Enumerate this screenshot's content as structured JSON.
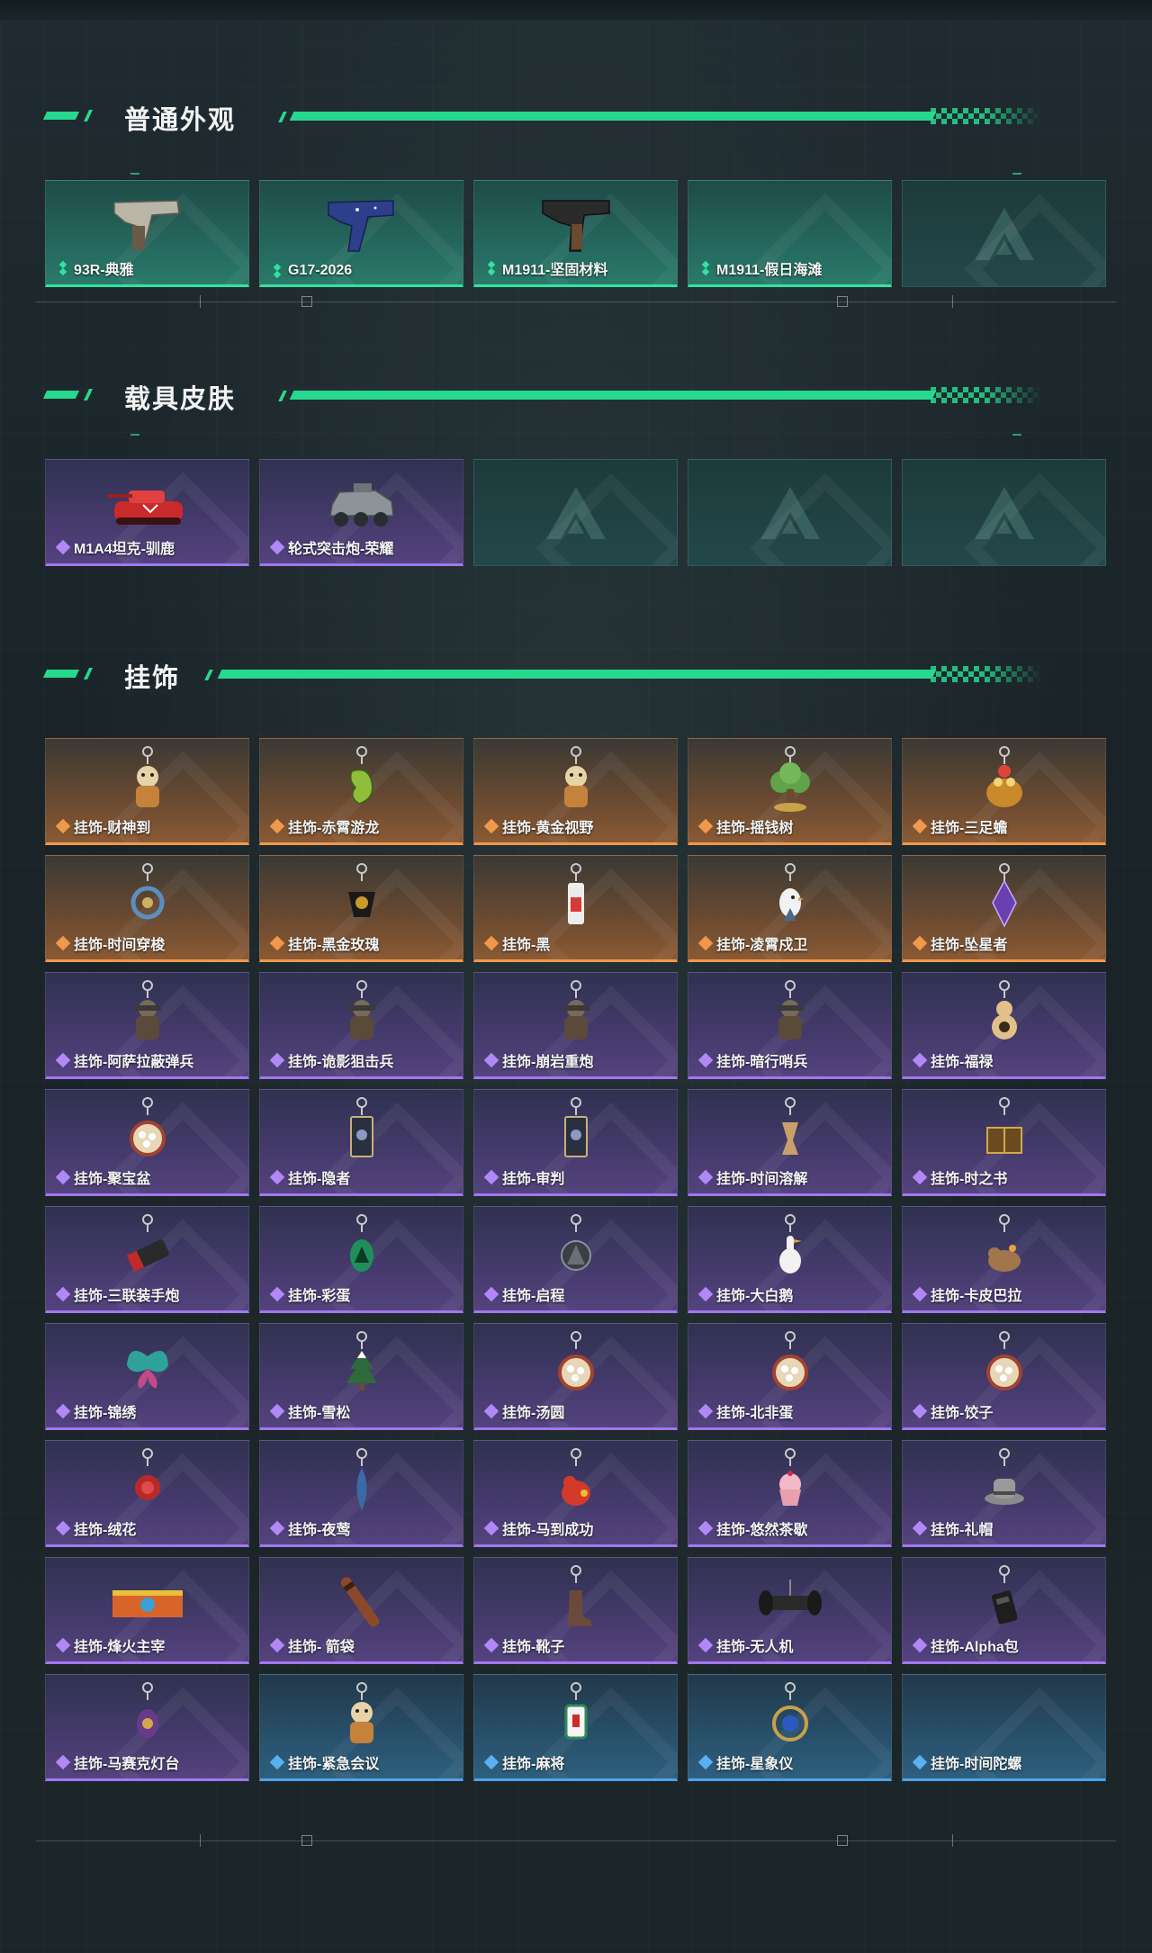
{
  "colors": {
    "accent": "#27d88f",
    "green": "#2fe3a2",
    "orange": "#f0984c",
    "purple": "#a276f0",
    "blue": "#4fa3e8"
  },
  "sections": [
    {
      "title": "普通外观",
      "items": [
        {
          "label": "93R-典雅",
          "rarity": "green",
          "icon": "pistol-silver-icon"
        },
        {
          "label": "G17-2026",
          "rarity": "green",
          "icon": "pistol-blue-icon"
        },
        {
          "label": "M1911-坚固材料",
          "rarity": "green",
          "icon": "pistol-black-icon"
        },
        {
          "label": "M1911-假日海滩",
          "rarity": "green",
          "icon": "pistol-empty-icon"
        },
        {
          "label": "",
          "rarity": "empty",
          "icon": "placeholder-logo-icon"
        }
      ]
    },
    {
      "title": "载具皮肤",
      "items": [
        {
          "label": "M1A4坦克-驯鹿",
          "rarity": "purple",
          "icon": "tank-icon"
        },
        {
          "label": "轮式突击炮-荣耀",
          "rarity": "purple",
          "icon": "armored-vehicle-icon"
        },
        {
          "label": "",
          "rarity": "empty",
          "icon": "placeholder-logo-icon"
        },
        {
          "label": "",
          "rarity": "empty",
          "icon": "placeholder-logo-icon"
        },
        {
          "label": "",
          "rarity": "empty",
          "icon": "placeholder-logo-icon"
        }
      ]
    },
    {
      "title": "挂饰",
      "items": [
        {
          "label": "挂饰-财神到",
          "rarity": "orange",
          "icon": "charm-figure-icon"
        },
        {
          "label": "挂饰-赤霄游龙",
          "rarity": "orange",
          "icon": "charm-dragon-icon"
        },
        {
          "label": "挂饰-黄金视野",
          "rarity": "orange",
          "icon": "charm-figure-icon"
        },
        {
          "label": "挂饰-摇钱树",
          "rarity": "orange",
          "icon": "charm-tree-icon"
        },
        {
          "label": "挂饰-三足蟾",
          "rarity": "orange",
          "icon": "charm-toad-icon"
        },
        {
          "label": "挂饰-时间穿梭",
          "rarity": "orange",
          "icon": "charm-ring-icon"
        },
        {
          "label": "挂饰-黑金玫瑰",
          "rarity": "orange",
          "icon": "charm-rose-icon"
        },
        {
          "label": "挂饰-黑",
          "rarity": "orange",
          "icon": "charm-tag-icon"
        },
        {
          "label": "挂饰-凌霄戍卫",
          "rarity": "orange",
          "icon": "charm-bird-icon"
        },
        {
          "label": "挂饰-坠星者",
          "rarity": "orange",
          "icon": "charm-crystal-icon"
        },
        {
          "label": "挂饰-阿萨拉蔽弹兵",
          "rarity": "purple",
          "icon": "charm-soldier-icon"
        },
        {
          "label": "挂饰-诡影狙击兵",
          "rarity": "purple",
          "icon": "charm-soldier-icon"
        },
        {
          "label": "挂饰-崩岩重炮",
          "rarity": "purple",
          "icon": "charm-soldier-icon"
        },
        {
          "label": "挂饰-暗行哨兵",
          "rarity": "purple",
          "icon": "charm-soldier-icon"
        },
        {
          "label": "挂饰-福禄",
          "rarity": "purple",
          "icon": "charm-gourd-icon"
        },
        {
          "label": "挂饰-聚宝盆",
          "rarity": "purple",
          "icon": "charm-bowl-icon"
        },
        {
          "label": "挂饰-隐者",
          "rarity": "purple",
          "icon": "charm-card-icon"
        },
        {
          "label": "挂饰-审判",
          "rarity": "purple",
          "icon": "charm-card-icon"
        },
        {
          "label": "挂饰-时间溶解",
          "rarity": "purple",
          "icon": "charm-clock-icon"
        },
        {
          "label": "挂饰-时之书",
          "rarity": "purple",
          "icon": "charm-book-icon"
        },
        {
          "label": "挂饰-三联装手炮",
          "rarity": "purple",
          "icon": "charm-launcher-icon"
        },
        {
          "label": "挂饰-彩蛋",
          "rarity": "purple",
          "icon": "charm-egg-icon"
        },
        {
          "label": "挂饰-启程",
          "rarity": "purple",
          "icon": "charm-emblem-icon"
        },
        {
          "label": "挂饰-大白鹅",
          "rarity": "purple",
          "icon": "charm-goose-icon"
        },
        {
          "label": "挂饰-卡皮巴拉",
          "rarity": "purple",
          "icon": "charm-capybara-icon"
        },
        {
          "label": "挂饰-锦绣",
          "rarity": "purple",
          "icon": "charm-butterfly-icon"
        },
        {
          "label": "挂饰-雪松",
          "rarity": "purple",
          "icon": "charm-pine-icon"
        },
        {
          "label": "挂饰-汤圆",
          "rarity": "purple",
          "icon": "charm-bowl-icon"
        },
        {
          "label": "挂饰-北非蛋",
          "rarity": "purple",
          "icon": "charm-bowl-icon"
        },
        {
          "label": "挂饰-饺子",
          "rarity": "purple",
          "icon": "charm-bowl-icon"
        },
        {
          "label": "挂饰-绒花",
          "rarity": "purple",
          "icon": "charm-flower-icon"
        },
        {
          "label": "挂饰-夜莺",
          "rarity": "purple",
          "icon": "charm-feather-icon"
        },
        {
          "label": "挂饰-马到成功",
          "rarity": "purple",
          "icon": "charm-horse-icon"
        },
        {
          "label": "挂饰-悠然茶歇",
          "rarity": "purple",
          "icon": "charm-cupcake-icon"
        },
        {
          "label": "挂饰-礼帽",
          "rarity": "purple",
          "icon": "charm-hat-icon"
        },
        {
          "label": "挂饰-烽火主宰",
          "rarity": "purple",
          "icon": "charm-banner-icon"
        },
        {
          "label": "挂饰- 箭袋",
          "rarity": "purple",
          "icon": "charm-quiver-icon"
        },
        {
          "label": "挂饰-靴子",
          "rarity": "purple",
          "icon": "charm-boot-icon"
        },
        {
          "label": "挂饰-无人机",
          "rarity": "purple",
          "icon": "charm-drone-icon"
        },
        {
          "label": "挂饰-Alpha包",
          "rarity": "purple",
          "icon": "charm-bag-icon"
        },
        {
          "label": "挂饰-马赛克灯台",
          "rarity": "purple",
          "icon": "charm-lamp-icon"
        },
        {
          "label": "挂饰-紧急会议",
          "rarity": "blue",
          "icon": "charm-figure-icon"
        },
        {
          "label": "挂饰-麻将",
          "rarity": "blue",
          "icon": "charm-mahjong-icon"
        },
        {
          "label": "挂饰-星象仪",
          "rarity": "blue",
          "icon": "charm-orb-icon"
        },
        {
          "label": "挂饰-时间陀螺",
          "rarity": "blue",
          "icon": "charm-empty-icon"
        }
      ]
    }
  ]
}
